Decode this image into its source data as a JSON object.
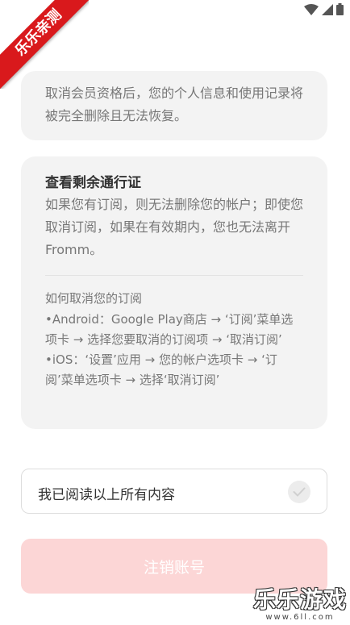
{
  "status_bar": {
    "icons": [
      "wifi-icon",
      "signal-icon",
      "battery-icon"
    ]
  },
  "ribbon": {
    "text": "乐乐亲测"
  },
  "notice_card": {
    "text": "取消会员资格后，您的个人信息和使用记录将被完全删除且无法恢复。"
  },
  "pass_card": {
    "title": "查看剩余通行证",
    "description": "如果您有订阅，则无法删除您的帐户；即使您取消订阅，如果在有效期内，您也无法离开Fromm。",
    "howto_title": "如何取消您的订阅",
    "android_step": "•Android：Google Play商店 → ‘订阅’菜单选项卡 → 选择您要取消的订阅项 → ‘取消订阅’",
    "ios_step": "•iOS：‘设置’应用 → 您的帐户选项卡 → ‘订阅’菜单选项卡 → 选择‘取消订阅’"
  },
  "agreement": {
    "label": "我已阅读以上所有内容",
    "checked": false
  },
  "delete_button": {
    "label": "注销账号",
    "enabled": false
  },
  "watermark": {
    "name": "乐乐游戏",
    "url": "www.6ll.com"
  },
  "colors": {
    "card_bg": "#f3f3f3",
    "button_disabled": "#fcd6d6",
    "ribbon": "#d9191c"
  }
}
